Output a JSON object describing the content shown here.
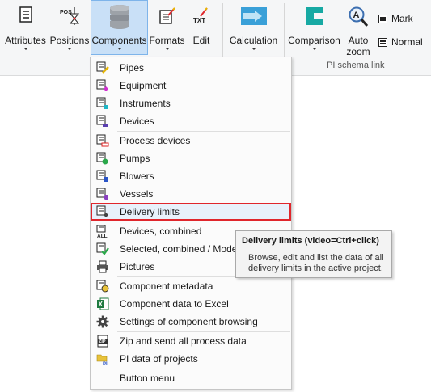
{
  "ribbon": {
    "buttons": [
      {
        "id": "attributes",
        "label": "Attributes",
        "icon": "attributes-icon"
      },
      {
        "id": "positions",
        "label": "Positions",
        "icon": "positions-icon"
      },
      {
        "id": "components",
        "label": "Components",
        "icon": "database-icon"
      },
      {
        "id": "formats",
        "label": "Formats",
        "icon": "formats-icon"
      },
      {
        "id": "edit",
        "label": "Edit",
        "icon": "txt-edit-icon"
      },
      {
        "id": "calculation",
        "label": "Calculation",
        "icon": "calculation-icon"
      },
      {
        "id": "comparison",
        "label": "Comparison",
        "icon": "comparison-icon"
      },
      {
        "id": "autozoom",
        "label": "Auto\nzoom",
        "icon": "zoom-icon"
      }
    ],
    "mark_label": "Mark",
    "normal_label": "Normal",
    "group_label": "PI schema link"
  },
  "menu": {
    "items": [
      {
        "label": "Pipes",
        "icon": "pipes-icon"
      },
      {
        "label": "Equipment",
        "icon": "equipment-icon"
      },
      {
        "label": "Instruments",
        "icon": "instruments-icon"
      },
      {
        "label": "Devices",
        "icon": "devices-icon"
      },
      {
        "label": "Process devices",
        "icon": "process-devices-icon"
      },
      {
        "label": "Pumps",
        "icon": "pumps-icon"
      },
      {
        "label": "Blowers",
        "icon": "blowers-icon"
      },
      {
        "label": "Vessels",
        "icon": "vessels-icon"
      },
      {
        "label": "Delivery limits",
        "icon": "delivery-limits-icon"
      },
      {
        "label": "Devices, combined",
        "icon": "all-icon"
      },
      {
        "label": "Selected, combined / Model",
        "icon": "checkmark-icon"
      },
      {
        "label": "Pictures",
        "icon": "printer-icon"
      },
      {
        "label": "Component metadata",
        "icon": "metadata-icon"
      },
      {
        "label": "Component data to Excel",
        "icon": "excel-icon"
      },
      {
        "label": "Settings of component browsing",
        "icon": "gear-icon"
      },
      {
        "label": "Zip and send all process data",
        "icon": "zip-icon"
      },
      {
        "label": "PI data of projects",
        "icon": "pi-folder-icon"
      },
      {
        "label": "Button menu",
        "icon": ""
      }
    ]
  },
  "tooltip": {
    "title": "Delivery limits (video=Ctrl+click)",
    "body": "Browse, edit and list the data of all delivery limits in the active project."
  },
  "colors": {
    "highlight_border": "#e0262c",
    "active_button": "#c9e0f7",
    "calc_icon": "#3aa0d8",
    "teal": "#17a9a3"
  }
}
